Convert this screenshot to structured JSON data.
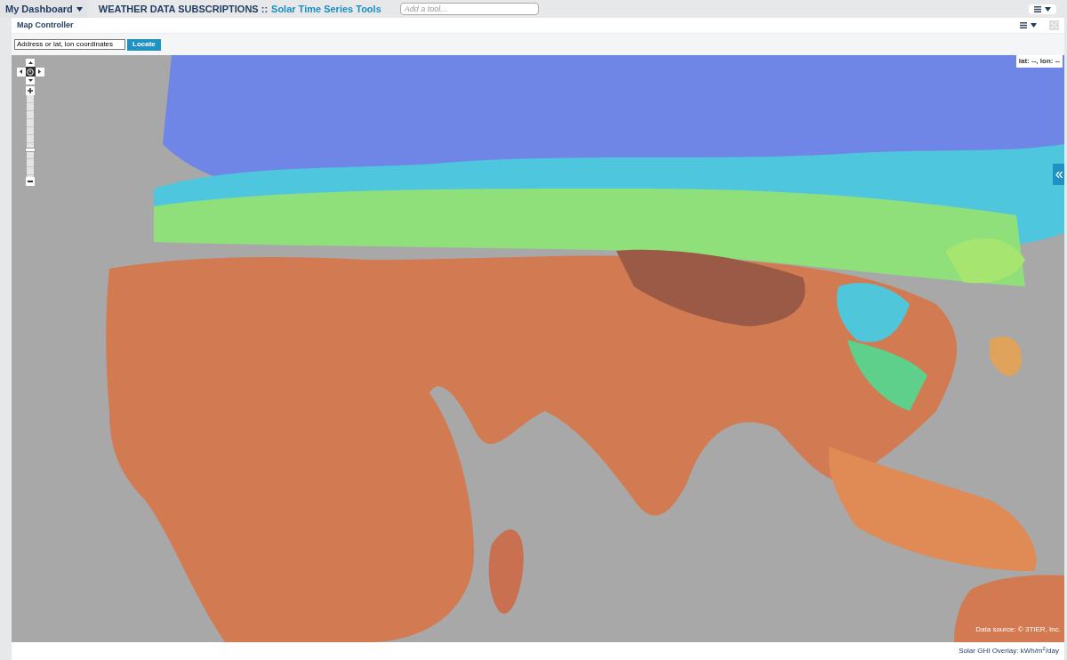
{
  "top_bar": {
    "dashboard_menu": "My Dashboard",
    "breadcrumb_section": "WEATHER DATA SUBSCRIPTIONS ::",
    "breadcrumb_page": "Solar Time Series Tools",
    "tool_search": {
      "placeholder": "Add a tool..."
    }
  },
  "panel": {
    "title": "Map Controller",
    "locate": {
      "placeholder": "Address or lat, lon coordinates",
      "button": "Locate"
    }
  },
  "map": {
    "kind": "picture",
    "coordinates": "lat: --, lon: --",
    "zoom": {
      "level": 0.33
    },
    "attribution": "Data source: © 3TIER, Inc."
  },
  "footer": {
    "legend": "Solar GHI Overlay: kWh/m$^{2}$/day"
  }
}
